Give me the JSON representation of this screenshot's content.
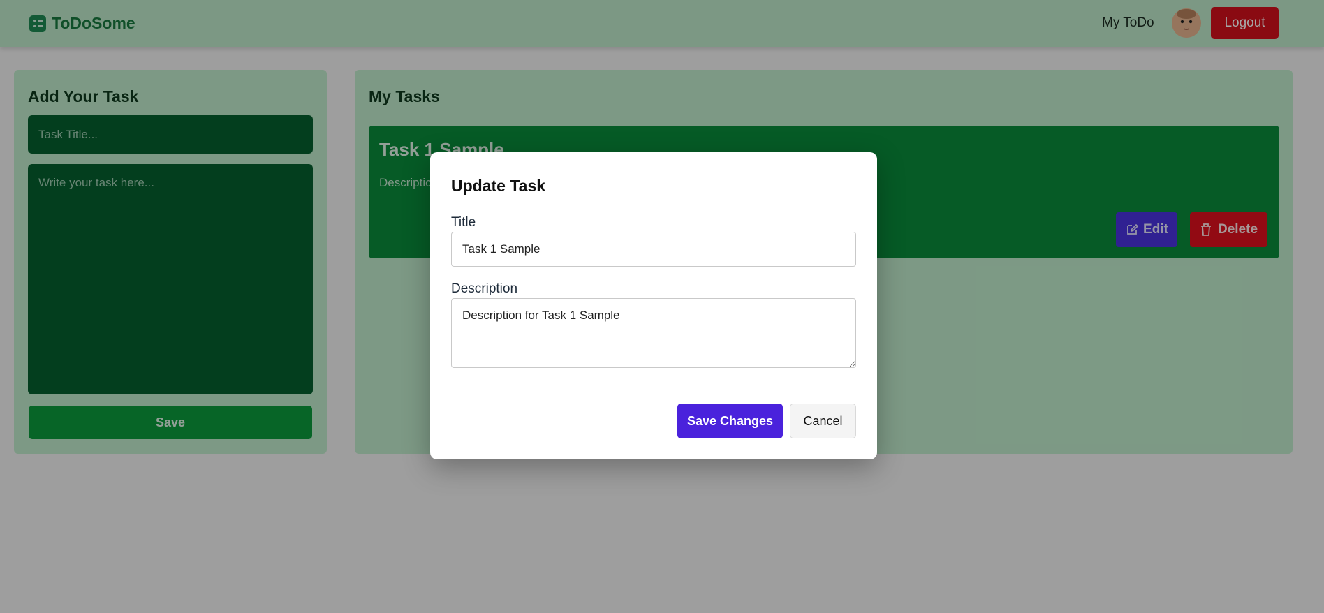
{
  "app": {
    "brand": "ToDoSome"
  },
  "nav": {
    "my_todo": "My ToDo",
    "logout": "Logout"
  },
  "add_task": {
    "heading": "Add Your Task",
    "title_placeholder": "Task Title...",
    "desc_placeholder": "Write your task here...",
    "save_label": "Save"
  },
  "tasks": {
    "heading": "My Tasks",
    "items": [
      {
        "title": "Task 1 Sample",
        "desc": "Description for Task 1 Sample",
        "edit_label": "Edit",
        "delete_label": "Delete"
      }
    ]
  },
  "modal": {
    "heading": "Update Task",
    "title_label": "Title",
    "title_value": "Task 1 Sample",
    "desc_label": "Description",
    "desc_value": "Description for Task 1 Sample",
    "save_label": "Save Changes",
    "cancel_label": "Cancel"
  },
  "colors": {
    "brand": "#197a3f",
    "panel": "#c0eccc",
    "input": "#06602e",
    "primary": "#4a22dc",
    "danger": "#d5101d"
  },
  "icons": {
    "brand": "checklist-icon",
    "edit": "edit-icon",
    "delete": "trash-icon"
  }
}
